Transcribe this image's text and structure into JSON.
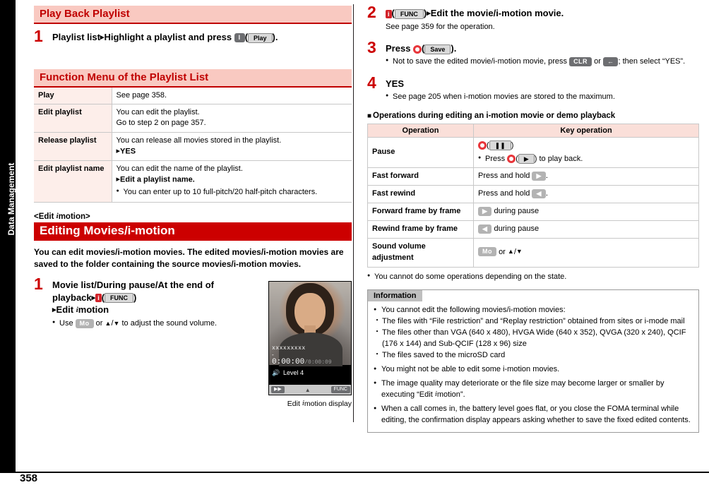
{
  "page": {
    "number": "358",
    "spine_label": "Data Management"
  },
  "left": {
    "playback_title": "Play Back Playlist",
    "step1": {
      "num": "1",
      "text_a": "Playlist list",
      "text_b": "Highlight a playlist and press",
      "key": "l",
      "softkey": "Play",
      "tail": "."
    },
    "function_menu_title": "Function Menu of the Playlist List",
    "menu_rows": [
      {
        "key": "Play",
        "desc": "See page 358."
      },
      {
        "key": "Edit playlist",
        "desc": "You can edit the playlist.\nGo to step 2 on page 357."
      },
      {
        "key": "Release playlist",
        "desc": "You can release all movies stored in the playlist.",
        "sub": "YES"
      },
      {
        "key": "Edit playlist name",
        "desc": "You can edit the name of the playlist.",
        "sub": "Edit a playlist name.",
        "bullet": "You can enter up to 10 full-pitch/20 half-pitch characters."
      }
    ],
    "edit_heading_angle": "<Edit  motion>",
    "edit_heading_main": "Editing Movies/i-motion",
    "edit_intro": "You can edit movies/i-motion movies. The edited movies/i-motion movies are saved to the folder containing the source movies/i-motion movies.",
    "step1b": {
      "num": "1",
      "line1": "Movie list/During pause/At the end of",
      "line2": "playback",
      "key1": "i",
      "softkey1": "FUNC",
      "line3": "Edit   motion",
      "bullet": "Use",
      "bullet_key": "Mo",
      "bullet_tail": "or  /  to adjust the sound volume."
    },
    "phone": {
      "name": "xxxxxxxxx",
      "dash": "-",
      "time": "0:00:00",
      "time_total": "/0:00:09",
      "level_label": "Level",
      "level_value": "4",
      "softkey_left": "",
      "softkey_mid": "",
      "softkey_right": "FUNC"
    },
    "phone_caption": "Edit  motion display"
  },
  "right": {
    "step2": {
      "num": "2",
      "key": "i",
      "softkey": "FUNC",
      "text": "Edit the movie/i-motion movie.",
      "sub": "See page 359 for the operation."
    },
    "step3": {
      "num": "3",
      "label": "Press",
      "softkey": "Save",
      "tail": ".",
      "bullet": "Not to save the edited movie/i-motion movie, press        or      ; then select “YES”.",
      "bullet_key1": "CLR",
      "bullet_key2": "←"
    },
    "step4": {
      "num": "4",
      "head": "YES",
      "bullet": "See page 205 when i-motion movies are stored to the maximum."
    },
    "ops_heading": "Operations during editing an i-motion movie or demo playback",
    "ops_table": {
      "headers": [
        "Operation",
        "Key operation"
      ],
      "rows": [
        {
          "op": "Pause",
          "key_text": "",
          "key_sub": "Press        (        ) to play back."
        },
        {
          "op": "Fast forward",
          "key_text": "Press and hold"
        },
        {
          "op": "Fast rewind",
          "key_text": "Press and hold"
        },
        {
          "op": "Forward frame by frame",
          "key_text": "during pause"
        },
        {
          "op": "Rewind frame by frame",
          "key_text": "during pause"
        },
        {
          "op": "Sound volume adjustment",
          "key_text": "or"
        }
      ]
    },
    "ops_note": "You cannot do some operations depending on the state.",
    "information": {
      "title": "Information",
      "items": [
        {
          "text": "You cannot edit the following movies/i-motion movies:",
          "subs": [
            "The files with “File restriction” and “Replay restriction” obtained from sites or i-mode mail",
            "The files other than VGA (640 x 480), HVGA Wide (640 x 352), QVGA (320 x 240), QCIF (176 x 144) and Sub-QCIF (128 x 96) size",
            "The files saved to the microSD card"
          ]
        },
        {
          "text": "You might not be able to edit some i-motion movies."
        },
        {
          "text": "The image quality may deteriorate or the file size may become larger or smaller by executing “Edit  motion”."
        },
        {
          "text": "When a call comes in, the battery level goes flat, or you close the FOMA terminal while editing, the confirmation display appears asking whether to save the fixed edited contents."
        }
      ]
    }
  }
}
